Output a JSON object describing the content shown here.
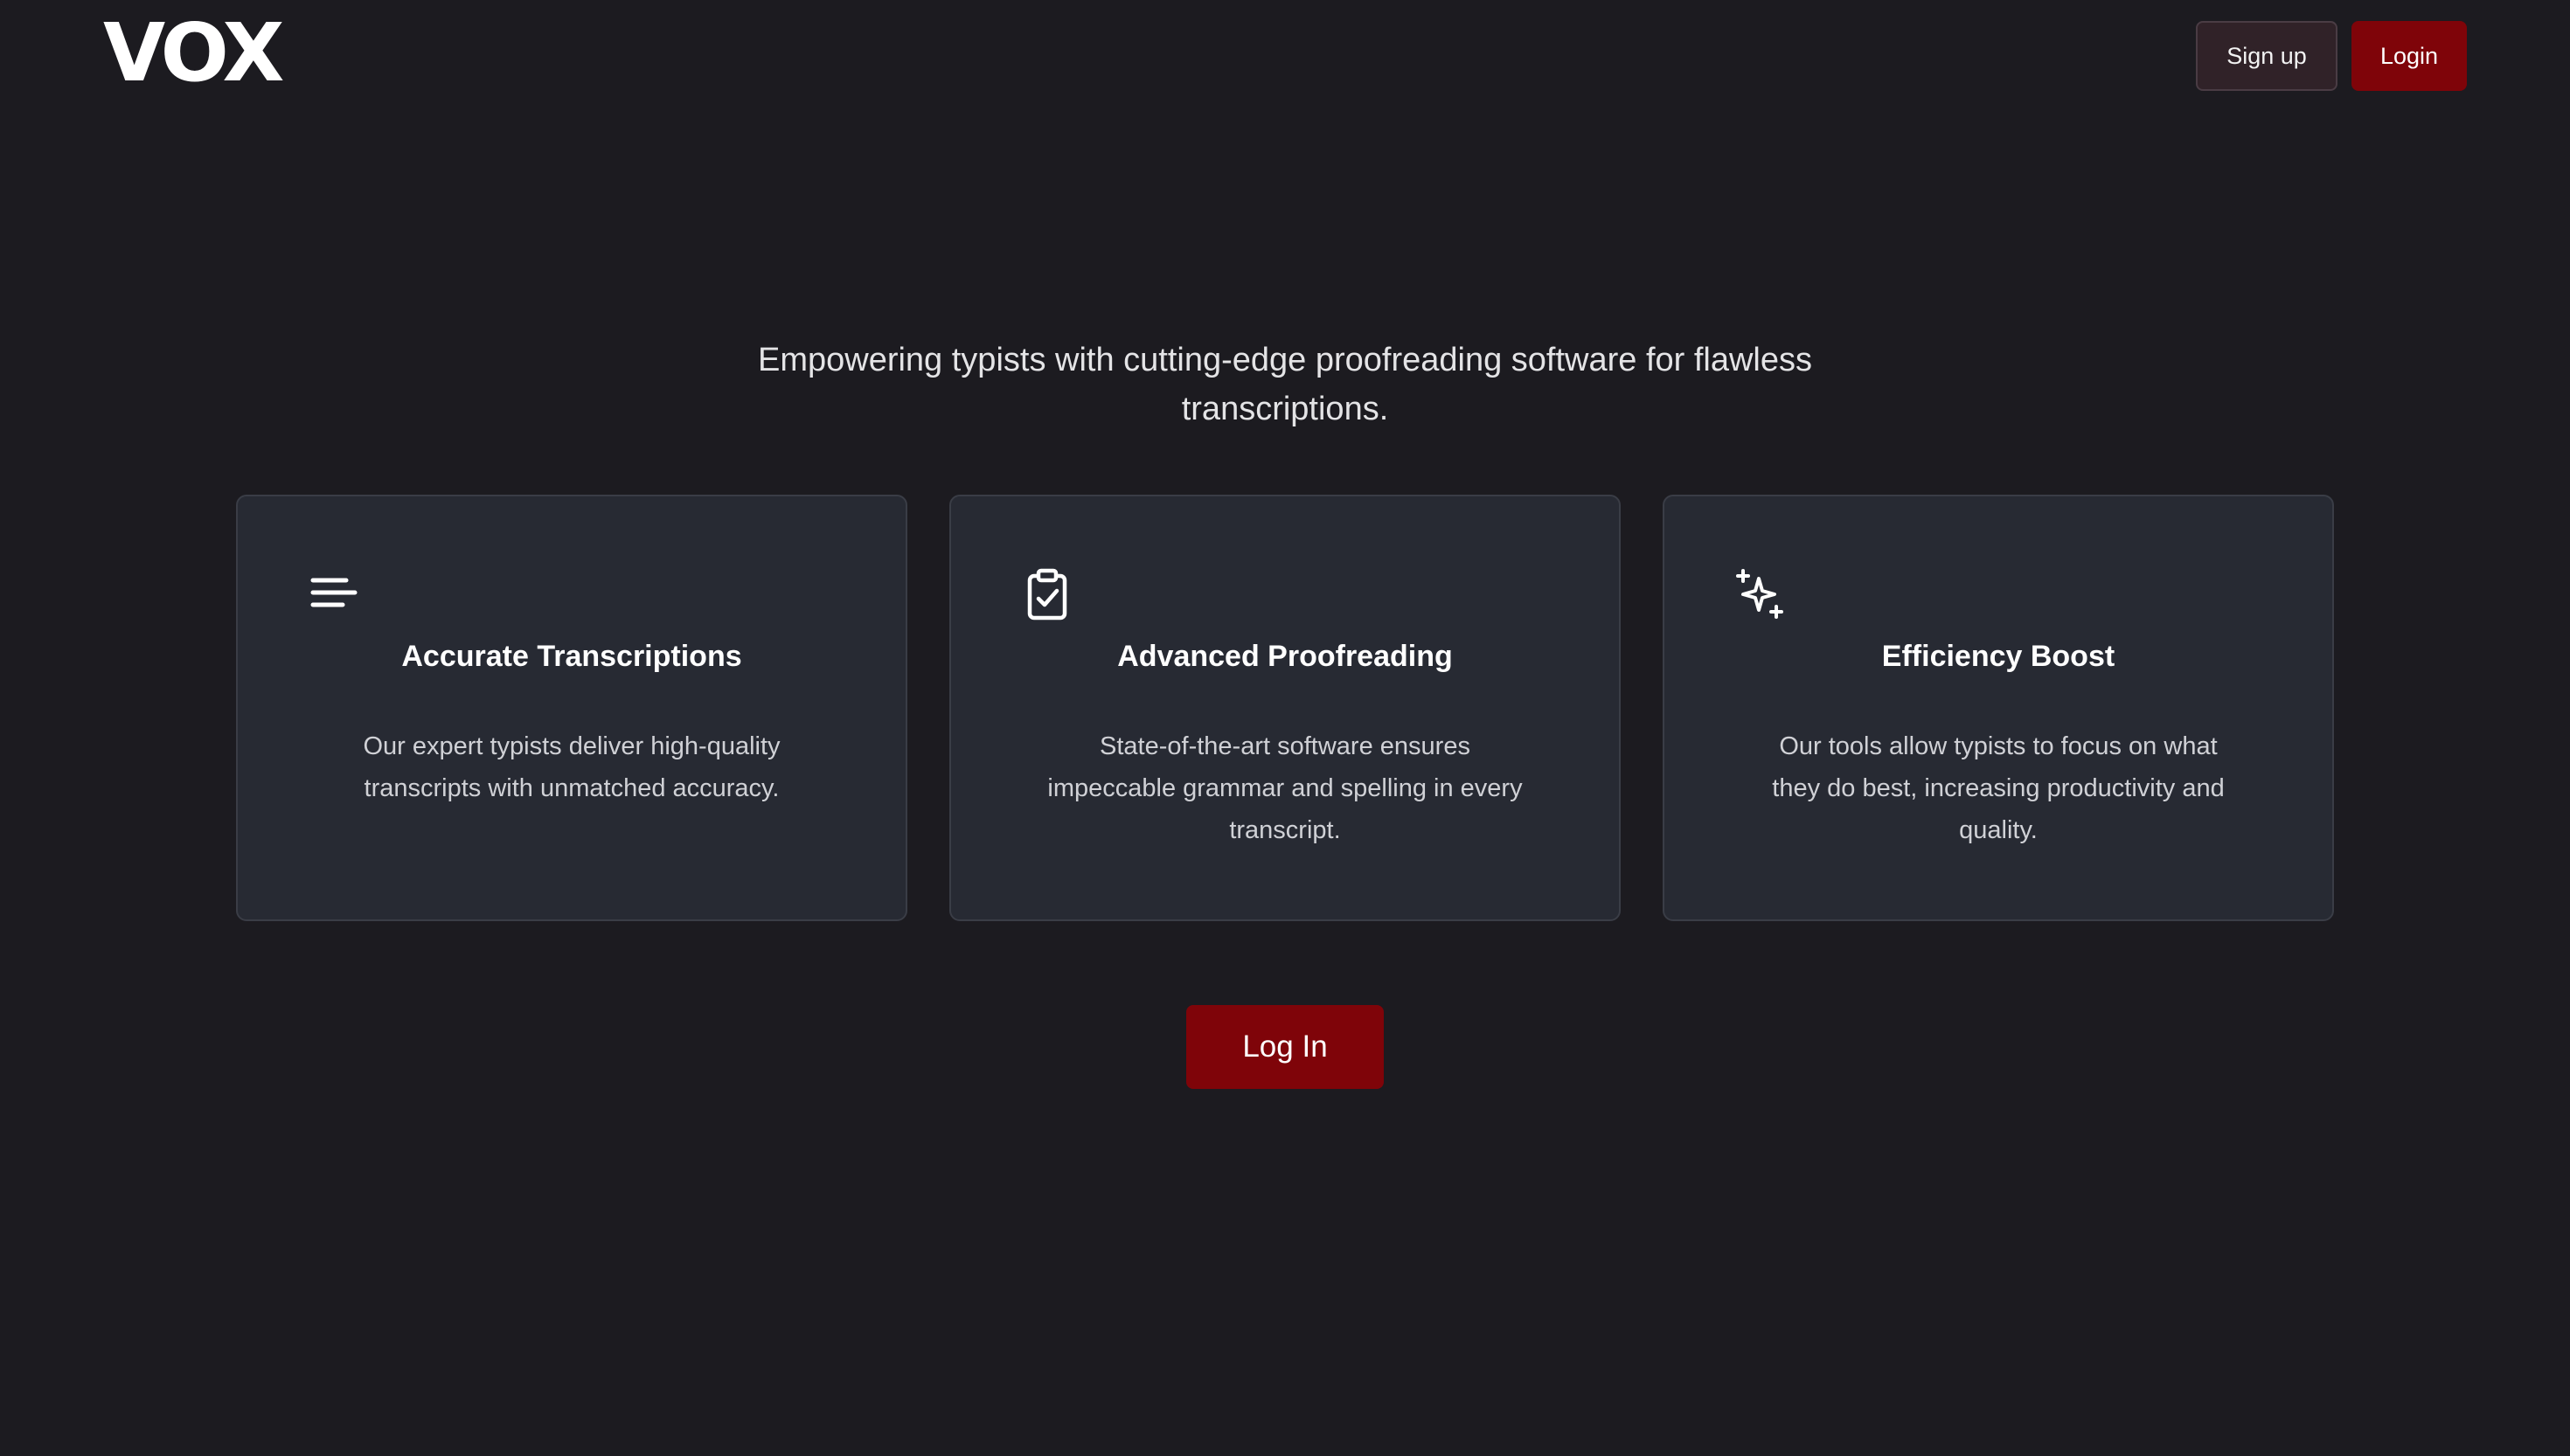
{
  "header": {
    "logo_text": "VOX",
    "signup_label": "Sign up",
    "login_label": "Login"
  },
  "hero": {
    "tagline": "Empowering typists with cutting‑edge proofreading software for flawless transcriptions."
  },
  "features": [
    {
      "icon": "text-lines-icon",
      "title": "Accurate Transcriptions",
      "description": "Our expert typists deliver high‑quality transcripts with unmatched accuracy."
    },
    {
      "icon": "clipboard-check-icon",
      "title": "Advanced Proofreading",
      "description": "State‑of‑the‑art software ensures impeccable grammar and spelling in every transcript."
    },
    {
      "icon": "sparkles-icon",
      "title": "Efficiency Boost",
      "description": "Our tools allow typists to focus on what they do best, increasing productivity and quality."
    }
  ],
  "cta": {
    "label": "Log In"
  },
  "colors": {
    "background": "#1c1b20",
    "card_background": "#272a33",
    "accent": "#7f0409",
    "signup_background": "#302228"
  }
}
